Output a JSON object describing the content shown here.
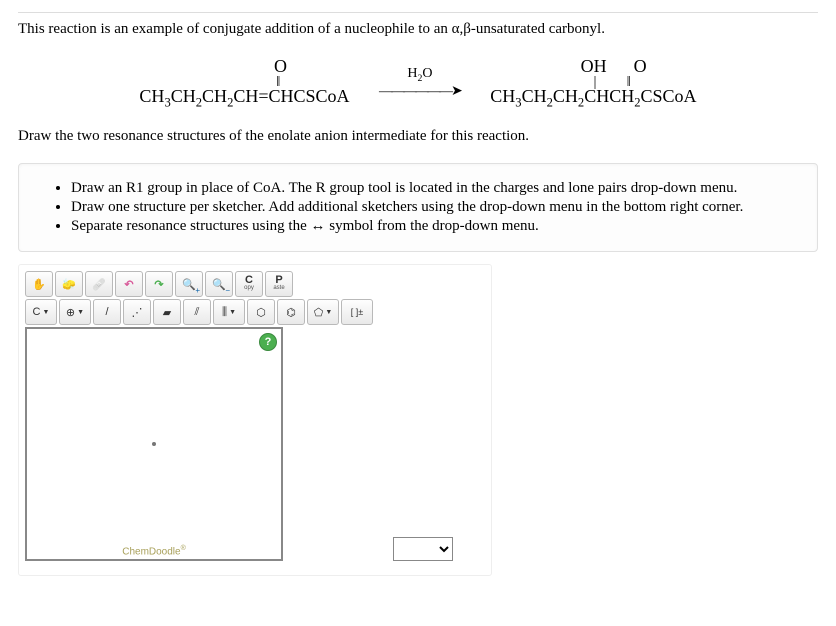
{
  "problem": {
    "intro": "This reaction is an example of conjugate addition of a nucleophile to an α,β-unsaturated carbonyl.",
    "prompt": "Draw the two resonance structures of the enolate anion intermediate for this reaction."
  },
  "reaction": {
    "reactant_top": "O",
    "reactant_bond": "‖",
    "reactant_main": "CH3CH2CH2CH=CHCSCoA",
    "arrow_reagent": "H2O",
    "product_top_left": "OH",
    "product_top_right": "O",
    "product_bond_left": "|",
    "product_bond_right": "‖",
    "product_main": "CH3CH2CH2CHCH2CSCoA"
  },
  "instructions": [
    "Draw an R1 group in place of CoA. The R group tool is located in the charges and lone pairs drop-down menu.",
    "Draw one structure per sketcher. Add additional sketchers using the drop-down menu in the bottom right corner.",
    "Separate resonance structures using the ↔ symbol from the drop-down menu."
  ],
  "toolbar": {
    "copy_top": "C",
    "copy_bottom": "opy",
    "paste_top": "P",
    "paste_bottom": "aste",
    "atom_label": "C",
    "help": "?",
    "lasso": "⌇",
    "chemdoodle": "ChemDoodle"
  },
  "icons": {
    "hand": "✋",
    "clear": "🧽",
    "erase": "🩹",
    "undo": "↶",
    "redo": "↷",
    "zoom_in": "🔍",
    "zoom_out": "🔍",
    "charge_menu": "⊕",
    "single_bond": "/",
    "dotted_bond": "⋰",
    "wedge": "▰",
    "double_bond": "⫽",
    "triple_bond": "⫼",
    "hexagon": "⬡",
    "benzene": "⌬",
    "pentagon": "⬠",
    "bracket": "[ ]±"
  }
}
